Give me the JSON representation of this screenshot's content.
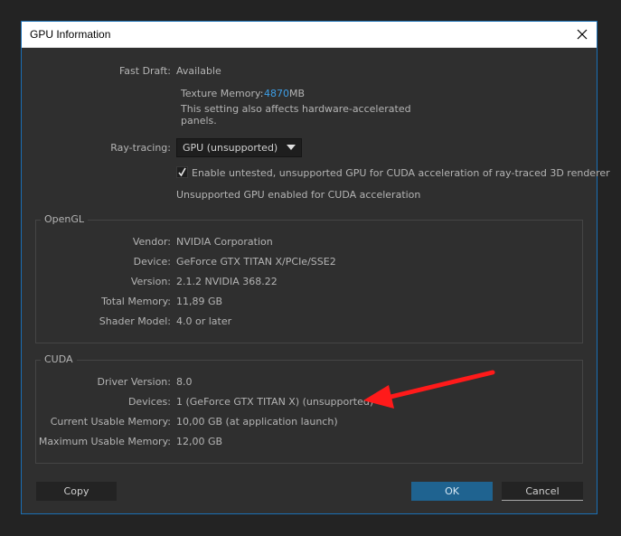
{
  "window": {
    "title": "GPU Information"
  },
  "fast_draft": {
    "label": "Fast Draft:",
    "value": "Available",
    "texture_memory_label": "Texture Memory:",
    "texture_memory_value": "4870",
    "texture_memory_unit": "MB",
    "note_line1": "This setting also affects hardware-accelerated",
    "note_line2": "panels."
  },
  "ray_tracing": {
    "label": "Ray-tracing:",
    "selected": "GPU (unsupported)",
    "checkbox_checked": true,
    "checkbox_label": "Enable untested, unsupported GPU for CUDA acceleration of ray-traced 3D renderer",
    "status": "Unsupported GPU enabled for CUDA acceleration"
  },
  "opengl": {
    "group_title": "OpenGL",
    "rows": [
      {
        "label": "Vendor:",
        "value": "NVIDIA Corporation"
      },
      {
        "label": "Device:",
        "value": "GeForce GTX TITAN X/PCIe/SSE2"
      },
      {
        "label": "Version:",
        "value": "2.1.2 NVIDIA 368.22"
      },
      {
        "label": "Total Memory:",
        "value": "11,89 GB"
      },
      {
        "label": "Shader Model:",
        "value": "4.0 or later"
      }
    ]
  },
  "cuda": {
    "group_title": "CUDA",
    "rows": [
      {
        "label": "Driver Version:",
        "value": "8.0"
      },
      {
        "label": "Devices:",
        "value": "1 (GeForce GTX TITAN X) (unsupported)"
      },
      {
        "label": "Current Usable Memory:",
        "value": "10,00 GB (at application launch)"
      },
      {
        "label": "Maximum Usable Memory:",
        "value": "12,00 GB"
      }
    ]
  },
  "buttons": {
    "copy": "Copy",
    "ok": "OK",
    "cancel": "Cancel"
  },
  "colors": {
    "accent": "#3d9ee6",
    "annotation_arrow": "#ff1a1a",
    "ok_button": "#1f6390"
  }
}
